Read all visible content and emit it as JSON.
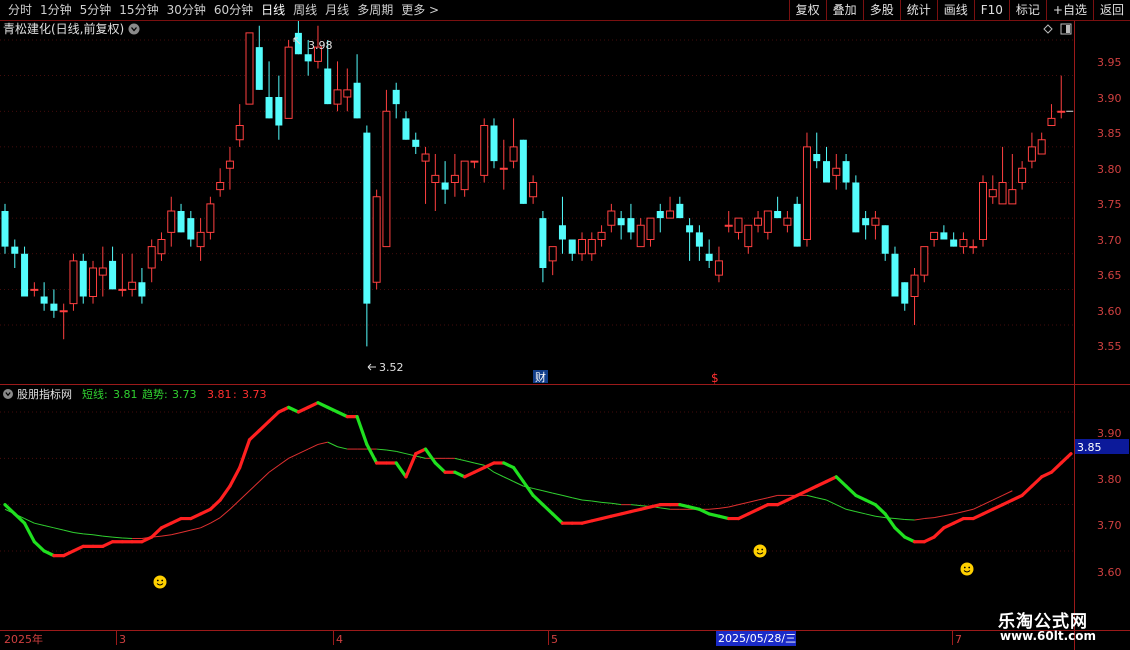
{
  "toolbar": {
    "periods": [
      "分时",
      "1分钟",
      "5分钟",
      "15分钟",
      "30分钟",
      "60分钟",
      "日线",
      "周线",
      "月线",
      "多周期",
      "更多 >"
    ],
    "active_period": "日线",
    "actions": [
      "复权",
      "叠加",
      "多股",
      "统计",
      "画线",
      "F10",
      "标记",
      "+自选",
      "返回"
    ]
  },
  "main_panel": {
    "title": "青松建化(日线,前复权)",
    "y_ticks": [
      "3.95",
      "3.90",
      "3.85",
      "3.80",
      "3.75",
      "3.70",
      "3.65",
      "3.60",
      "3.55"
    ],
    "high_label": "3.98",
    "low_label": "3.52",
    "markers": [
      "财",
      "$"
    ]
  },
  "indicator_panel": {
    "name": "股朋指标网",
    "short_label": "短线:",
    "short_value": "3.81",
    "trend_label": "趋势:",
    "trend_value": "3.73",
    "v3": "3.81",
    "v4": "3.73",
    "y_ticks": [
      "3.90",
      "3.80",
      "3.70",
      "3.60"
    ],
    "current_price_tag": "3.85"
  },
  "x_axis": {
    "labels": [
      "2025年",
      "3",
      "4",
      "5",
      "2025/05/28/三",
      "7"
    ]
  },
  "watermark": {
    "title": "乐淘公式网",
    "url": "www.60lt.com"
  },
  "colors": {
    "up": "#ff4040",
    "down": "#54fcfc",
    "short_up": "#ff2020",
    "short_down": "#20e020",
    "trend_up": "#e03030",
    "trend_down": "#30d030",
    "axis": "#9b1a1a",
    "smiley": "#ffd000"
  },
  "chart_data": {
    "type": "candlestick",
    "ylim": [
      3.52,
      3.98
    ],
    "candles": [
      [
        3.71,
        3.72,
        3.65,
        3.66
      ],
      [
        3.66,
        3.67,
        3.63,
        3.65
      ],
      [
        3.65,
        3.66,
        3.6,
        3.59
      ],
      [
        3.6,
        3.61,
        3.59,
        3.6
      ],
      [
        3.59,
        3.61,
        3.57,
        3.58
      ],
      [
        3.58,
        3.6,
        3.56,
        3.57
      ],
      [
        3.57,
        3.58,
        3.53,
        3.57
      ],
      [
        3.58,
        3.65,
        3.57,
        3.64
      ],
      [
        3.64,
        3.65,
        3.58,
        3.59
      ],
      [
        3.59,
        3.64,
        3.58,
        3.63
      ],
      [
        3.62,
        3.66,
        3.59,
        3.63
      ],
      [
        3.64,
        3.66,
        3.61,
        3.6
      ],
      [
        3.6,
        3.65,
        3.59,
        3.6
      ],
      [
        3.6,
        3.65,
        3.59,
        3.61
      ],
      [
        3.61,
        3.63,
        3.58,
        3.59
      ],
      [
        3.63,
        3.67,
        3.61,
        3.66
      ],
      [
        3.65,
        3.68,
        3.64,
        3.67
      ],
      [
        3.68,
        3.73,
        3.66,
        3.71
      ],
      [
        3.71,
        3.72,
        3.68,
        3.68
      ],
      [
        3.7,
        3.71,
        3.66,
        3.67
      ],
      [
        3.66,
        3.7,
        3.64,
        3.68
      ],
      [
        3.68,
        3.73,
        3.67,
        3.72
      ],
      [
        3.74,
        3.77,
        3.73,
        3.75
      ],
      [
        3.77,
        3.8,
        3.74,
        3.78
      ],
      [
        3.81,
        3.86,
        3.8,
        3.83
      ],
      [
        3.86,
        3.96,
        3.86,
        3.96
      ],
      [
        3.94,
        3.97,
        3.88,
        3.88
      ],
      [
        3.87,
        3.92,
        3.84,
        3.84
      ],
      [
        3.87,
        3.9,
        3.81,
        3.83
      ],
      [
        3.84,
        3.95,
        3.84,
        3.94
      ],
      [
        3.96,
        3.98,
        3.93,
        3.93
      ],
      [
        3.93,
        3.95,
        3.9,
        3.92
      ],
      [
        3.92,
        3.97,
        3.91,
        3.94
      ],
      [
        3.91,
        3.95,
        3.86,
        3.86
      ],
      [
        3.86,
        3.92,
        3.85,
        3.88
      ],
      [
        3.87,
        3.91,
        3.85,
        3.88
      ],
      [
        3.89,
        3.93,
        3.84,
        3.84
      ],
      [
        3.82,
        3.83,
        3.52,
        3.58
      ],
      [
        3.61,
        3.74,
        3.6,
        3.73
      ],
      [
        3.66,
        3.88,
        3.66,
        3.85
      ],
      [
        3.88,
        3.89,
        3.84,
        3.86
      ],
      [
        3.84,
        3.85,
        3.81,
        3.81
      ],
      [
        3.81,
        3.82,
        3.79,
        3.8
      ],
      [
        3.78,
        3.8,
        3.72,
        3.79
      ],
      [
        3.75,
        3.79,
        3.71,
        3.76
      ],
      [
        3.75,
        3.78,
        3.72,
        3.74
      ],
      [
        3.75,
        3.79,
        3.73,
        3.76
      ],
      [
        3.74,
        3.78,
        3.73,
        3.78
      ],
      [
        3.78,
        3.78,
        3.77,
        3.78
      ],
      [
        3.76,
        3.84,
        3.75,
        3.83
      ],
      [
        3.83,
        3.84,
        3.77,
        3.78
      ],
      [
        3.77,
        3.81,
        3.74,
        3.77
      ],
      [
        3.78,
        3.84,
        3.77,
        3.8
      ],
      [
        3.81,
        3.81,
        3.72,
        3.72
      ],
      [
        3.73,
        3.76,
        3.72,
        3.75
      ],
      [
        3.7,
        3.71,
        3.61,
        3.63
      ],
      [
        3.64,
        3.66,
        3.62,
        3.66
      ],
      [
        3.69,
        3.73,
        3.65,
        3.67
      ],
      [
        3.67,
        3.67,
        3.64,
        3.65
      ],
      [
        3.65,
        3.68,
        3.64,
        3.67
      ],
      [
        3.65,
        3.68,
        3.64,
        3.67
      ],
      [
        3.67,
        3.69,
        3.66,
        3.68
      ],
      [
        3.69,
        3.72,
        3.68,
        3.71
      ],
      [
        3.7,
        3.71,
        3.67,
        3.69
      ],
      [
        3.7,
        3.72,
        3.67,
        3.68
      ],
      [
        3.66,
        3.7,
        3.66,
        3.69
      ],
      [
        3.67,
        3.7,
        3.66,
        3.7
      ],
      [
        3.71,
        3.72,
        3.68,
        3.7
      ],
      [
        3.7,
        3.73,
        3.7,
        3.71
      ],
      [
        3.72,
        3.73,
        3.7,
        3.7
      ],
      [
        3.69,
        3.7,
        3.64,
        3.68
      ],
      [
        3.68,
        3.69,
        3.64,
        3.66
      ],
      [
        3.65,
        3.67,
        3.63,
        3.64
      ],
      [
        3.62,
        3.66,
        3.61,
        3.64
      ],
      [
        3.69,
        3.71,
        3.68,
        3.69
      ],
      [
        3.68,
        3.7,
        3.67,
        3.7
      ],
      [
        3.66,
        3.69,
        3.65,
        3.69
      ],
      [
        3.69,
        3.71,
        3.68,
        3.7
      ],
      [
        3.68,
        3.71,
        3.67,
        3.71
      ],
      [
        3.71,
        3.73,
        3.7,
        3.7
      ],
      [
        3.69,
        3.71,
        3.68,
        3.7
      ],
      [
        3.72,
        3.73,
        3.66,
        3.66
      ],
      [
        3.67,
        3.82,
        3.66,
        3.8
      ],
      [
        3.79,
        3.82,
        3.77,
        3.78
      ],
      [
        3.78,
        3.8,
        3.75,
        3.75
      ],
      [
        3.76,
        3.79,
        3.74,
        3.77
      ],
      [
        3.78,
        3.79,
        3.74,
        3.75
      ],
      [
        3.75,
        3.76,
        3.68,
        3.68
      ],
      [
        3.7,
        3.71,
        3.67,
        3.69
      ],
      [
        3.69,
        3.71,
        3.67,
        3.7
      ],
      [
        3.69,
        3.69,
        3.64,
        3.65
      ],
      [
        3.65,
        3.66,
        3.59,
        3.59
      ],
      [
        3.61,
        3.61,
        3.57,
        3.58
      ],
      [
        3.59,
        3.63,
        3.55,
        3.62
      ],
      [
        3.62,
        3.66,
        3.61,
        3.66
      ],
      [
        3.67,
        3.68,
        3.66,
        3.68
      ],
      [
        3.68,
        3.69,
        3.67,
        3.67
      ],
      [
        3.67,
        3.68,
        3.66,
        3.66
      ],
      [
        3.66,
        3.68,
        3.65,
        3.67
      ],
      [
        3.66,
        3.67,
        3.65,
        3.66
      ],
      [
        3.67,
        3.76,
        3.66,
        3.75
      ],
      [
        3.73,
        3.76,
        3.72,
        3.74
      ],
      [
        3.72,
        3.8,
        3.72,
        3.75
      ],
      [
        3.72,
        3.79,
        3.72,
        3.74
      ],
      [
        3.75,
        3.78,
        3.74,
        3.77
      ],
      [
        3.78,
        3.82,
        3.77,
        3.8
      ],
      [
        3.79,
        3.82,
        3.79,
        3.81
      ],
      [
        3.83,
        3.86,
        3.83,
        3.84
      ],
      [
        3.85,
        3.9,
        3.84,
        3.85
      ]
    ],
    "short_line": [
      3.7,
      3.68,
      3.66,
      3.62,
      3.6,
      3.59,
      3.59,
      3.6,
      3.61,
      3.61,
      3.61,
      3.62,
      3.62,
      3.62,
      3.62,
      3.63,
      3.65,
      3.66,
      3.67,
      3.67,
      3.68,
      3.69,
      3.71,
      3.74,
      3.78,
      3.84,
      3.86,
      3.88,
      3.9,
      3.91,
      3.9,
      3.91,
      3.92,
      3.91,
      3.9,
      3.89,
      3.89,
      3.83,
      3.79,
      3.79,
      3.79,
      3.76,
      3.81,
      3.82,
      3.79,
      3.77,
      3.77,
      3.76,
      3.77,
      3.78,
      3.79,
      3.79,
      3.78,
      3.75,
      3.72,
      3.7,
      3.68,
      3.66,
      3.66,
      3.66,
      3.665,
      3.67,
      3.675,
      3.68,
      3.685,
      3.69,
      3.695,
      3.7,
      3.7,
      3.7,
      3.695,
      3.69,
      3.68,
      3.675,
      3.67,
      3.67,
      3.68,
      3.69,
      3.7,
      3.7,
      3.71,
      3.72,
      3.73,
      3.74,
      3.75,
      3.76,
      3.74,
      3.72,
      3.71,
      3.7,
      3.68,
      3.65,
      3.63,
      3.62,
      3.62,
      3.63,
      3.65,
      3.66,
      3.67,
      3.67,
      3.68,
      3.69,
      3.7,
      3.71,
      3.72,
      3.74,
      3.76,
      3.77,
      3.79,
      3.81
    ],
    "trend_line": [
      3.69,
      3.68,
      3.67,
      3.66,
      3.655,
      3.65,
      3.645,
      3.64,
      3.637,
      3.635,
      3.632,
      3.63,
      3.628,
      3.627,
      3.627,
      3.63,
      3.632,
      3.635,
      3.64,
      3.645,
      3.65,
      3.66,
      3.672,
      3.69,
      3.71,
      3.73,
      3.75,
      3.77,
      3.785,
      3.8,
      3.81,
      3.82,
      3.83,
      3.835,
      3.825,
      3.82,
      3.82,
      3.82,
      3.82,
      3.818,
      3.815,
      3.81,
      3.805,
      3.8,
      3.8,
      3.8,
      3.8,
      3.795,
      3.79,
      3.785,
      3.77,
      3.76,
      3.75,
      3.74,
      3.735,
      3.73,
      3.725,
      3.72,
      3.715,
      3.71,
      3.708,
      3.705,
      3.703,
      3.7,
      3.7,
      3.698,
      3.696,
      3.693,
      3.69,
      3.69,
      3.69,
      3.69,
      3.69,
      3.692,
      3.695,
      3.7,
      3.705,
      3.71,
      3.715,
      3.72,
      3.72,
      3.72,
      3.72,
      3.715,
      3.71,
      3.7,
      3.69,
      3.685,
      3.68,
      3.675,
      3.672,
      3.67,
      3.668,
      3.667,
      3.67,
      3.672,
      3.676,
      3.68,
      3.685,
      3.69,
      3.7,
      3.71,
      3.72,
      3.73
    ]
  }
}
